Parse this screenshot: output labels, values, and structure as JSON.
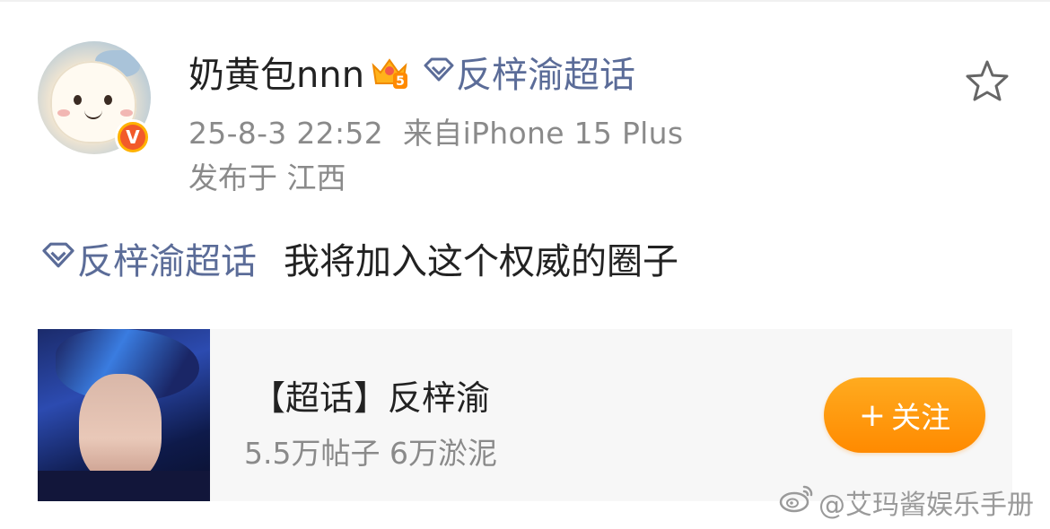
{
  "post": {
    "author": {
      "name": "奶黄包nnn",
      "verified_badge": "V",
      "level_badge": "5"
    },
    "supertopic": "反梓渝超话",
    "timestamp": "25-8-3 22:52",
    "source": "来自iPhone 15 Plus",
    "location": "发布于 江西",
    "text": "我将加入这个权威的圈子"
  },
  "card": {
    "title": "【超话】反梓渝",
    "stats": "5.5万帖子 6万淤泥",
    "follow_label": "关注",
    "follow_plus": "+"
  },
  "watermark": "@艾玛酱娱乐手册",
  "colors": {
    "link_blue": "#5b6c98",
    "meta_gray": "#8a8a8a",
    "follow_orange": "#ff9a10",
    "card_bg": "#f7f7f7"
  },
  "icons": {
    "favorite": "star-outline-icon",
    "supertopic": "diamond-icon",
    "crown": "crown-icon"
  }
}
